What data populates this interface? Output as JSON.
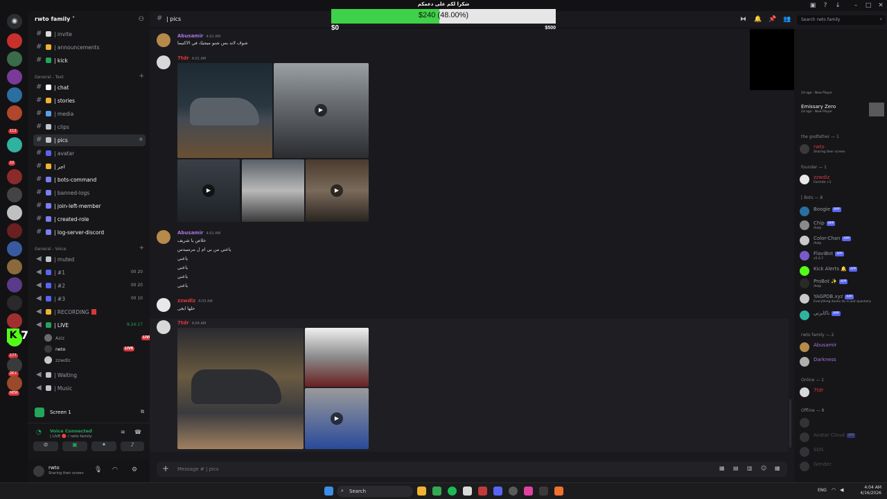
{
  "titlebar": {
    "controls": [
      "minimize",
      "maximize",
      "close"
    ]
  },
  "server": {
    "name": "rwto family",
    "categories": {
      "text": "General - Text",
      "voice": "General - Voice"
    },
    "channels_top": [
      {
        "name": "| invite",
        "emoji_color": "#d9d9d9"
      },
      {
        "name": "| announcements",
        "emoji_color": "#f0b232"
      },
      {
        "name": "| kick",
        "emoji_color": "#23a55a"
      }
    ],
    "text_channels": [
      {
        "name": "| chat",
        "emoji_color": "#ffffff"
      },
      {
        "name": "| stories",
        "emoji_color": "#f0b232"
      },
      {
        "name": "| media",
        "emoji_color": "#5aa0e6"
      },
      {
        "name": "| clips",
        "emoji_color": "#c0c4cc"
      },
      {
        "name": "| pics",
        "emoji_color": "#c0c4cc"
      },
      {
        "name": "| avatar",
        "emoji_color": "#5865f2"
      },
      {
        "name": "| اجر",
        "emoji_color": "#f0b232"
      },
      {
        "name": "| bots-command",
        "emoji_color": "#7b7ff2"
      },
      {
        "name": "| banned-logs",
        "emoji_color": "#7b7ff2"
      },
      {
        "name": "| join-left-member",
        "emoji_color": "#7b7ff2"
      },
      {
        "name": "| created-role",
        "emoji_color": "#7b7ff2"
      },
      {
        "name": "| log-server-discord",
        "emoji_color": "#7b7ff2"
      }
    ],
    "voice_channels": [
      {
        "name": "| muted",
        "count": ""
      },
      {
        "name": "| #1",
        "count": "00 20"
      },
      {
        "name": "| #2",
        "count": "00 20"
      },
      {
        "name": "| #3",
        "count": "00 10"
      },
      {
        "name": "| RECORDING",
        "count": ""
      },
      {
        "name": "| LIVE",
        "count": "9:24:17"
      }
    ],
    "voice_users": [
      {
        "name": "Aziz",
        "badge": "SOS"
      },
      {
        "name": "rwto",
        "badge": "LIVE"
      },
      {
        "name": "zzwdlz",
        "badge": ""
      }
    ],
    "voice_bottom": [
      {
        "name": "| Waiting"
      },
      {
        "name": "| Music"
      },
      {
        "name": "| AFK"
      }
    ],
    "rail_badges": [
      "112",
      "10",
      "177",
      "2K+",
      "NEW"
    ],
    "kick_counter": "7"
  },
  "screen_panel": {
    "label": "Screen 1"
  },
  "voice_panel": {
    "status": "Voice Connected",
    "location": "| LIVE 🔴 / rwto family"
  },
  "user_panel": {
    "name": "rwto",
    "status": "Sharing their screen"
  },
  "channel": {
    "title": "| pics",
    "composer_placeholder": "Message # | pics"
  },
  "search": {
    "placeholder": "Search rwto family"
  },
  "messages": [
    {
      "author": "Abusamir",
      "time": "4:01 AM",
      "text": "شوف لاند بس شنو ميجيك في الاكتيما",
      "color": "#a773e0"
    },
    {
      "author": "7tdr",
      "time": "4:01 AM",
      "text": "",
      "color": "#da373c"
    },
    {
      "author": "Abusamir",
      "time": "4:01 AM",
      "lines": [
        "خلاص يا شريف",
        "ياعني من بي ام ل مرسيدس",
        "ياعني",
        "ياعني",
        "ياعني",
        "ياعني"
      ],
      "color": "#a773e0"
    },
    {
      "author": "zzwdlz",
      "time": "4:03 AM",
      "text": "حلها ابغى",
      "color": "#da373c"
    },
    {
      "author": "7tdr",
      "time": "4:04 AM",
      "text": "",
      "color": "#da373c"
    }
  ],
  "donation": {
    "title": "شكرا لكم على دعمكم",
    "current": "$240",
    "percent": "(48.00%)",
    "progress": 0.48,
    "min": "$0",
    "max": "$500"
  },
  "members": {
    "top_activity": [
      {
        "name": "",
        "status": "2d ago · New Player"
      },
      {
        "name": "Emissary Zero",
        "status": "2d ago · New Player"
      }
    ],
    "groups": [
      {
        "title": "the godfather — 1",
        "items": [
          {
            "name": "rwto",
            "status": "Sharing their screen",
            "color": "#da373c"
          }
        ]
      },
      {
        "title": "founder — 1",
        "items": [
          {
            "name": "zzwdlz",
            "status": "Fortnite +1",
            "color": "#da373c"
          }
        ]
      },
      {
        "title": "[ Bots — 8",
        "items": [
          {
            "name": "Boogie",
            "status": "",
            "color": "#949ba4",
            "app": "APP"
          },
          {
            "name": "Chip",
            "status": "/help",
            "color": "#949ba4",
            "app": "APP"
          },
          {
            "name": "Color-Chan",
            "status": "/help",
            "color": "#949ba4",
            "app": "APP"
          },
          {
            "name": "FlaviBot",
            "status": "v5.6.7",
            "color": "#949ba4",
            "app": "APP"
          },
          {
            "name": "Kick Alerts 🔔",
            "status": "",
            "color": "#949ba4",
            "app": "APP"
          },
          {
            "name": "ProBot ✨",
            "status": "/help",
            "color": "#949ba4",
            "app": "APP"
          },
          {
            "name": "YAGPDB.xyz",
            "status": "Everything ducks do is just quackery.",
            "color": "#949ba4",
            "app": "APP"
          },
          {
            "name": "ناكابرتي",
            "status": "",
            "color": "#949ba4",
            "app": "APP"
          }
        ]
      },
      {
        "title": "rwto family — 2",
        "items": [
          {
            "name": "Abusamir",
            "status": "",
            "color": "#a773e0"
          },
          {
            "name": "Darkness",
            "status": "",
            "color": "#a773e0"
          }
        ]
      },
      {
        "title": "Online — 1",
        "items": [
          {
            "name": "7tdr",
            "status": "",
            "color": "#da373c"
          }
        ]
      },
      {
        "title": "Offline — 8",
        "items": [
          {
            "name": "",
            "status": "",
            "color": "#5c5f66"
          },
          {
            "name": "Avatar Cloud",
            "status": "",
            "color": "#5c5f66",
            "app": "APP"
          },
          {
            "name": "SOS",
            "status": "",
            "color": "#5c5f66"
          },
          {
            "name": "Gender",
            "status": "",
            "color": "#5c5f66"
          }
        ]
      }
    ]
  },
  "taskbar": {
    "search": "Search",
    "lang": "ENG",
    "time": "4:04 AM",
    "date": "4/16/2026"
  }
}
